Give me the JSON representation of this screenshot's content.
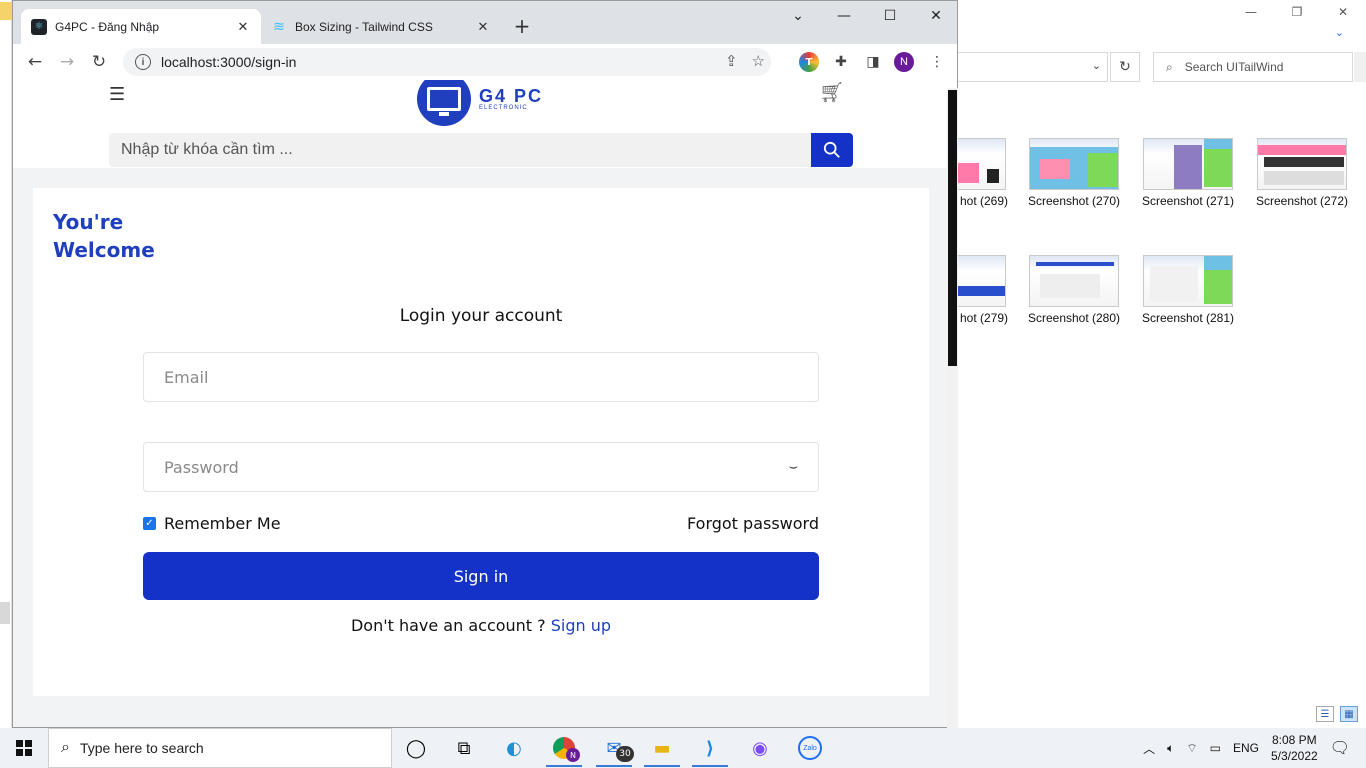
{
  "explorer": {
    "search_placeholder": "Search UITailWind",
    "thumbnails": [
      {
        "label": "hot (269)"
      },
      {
        "label": "Screenshot (270)"
      },
      {
        "label": "Screenshot (271)"
      },
      {
        "label": "Screenshot (272)"
      },
      {
        "label": "hot (279)"
      },
      {
        "label": "Screenshot (280)"
      },
      {
        "label": "Screenshot (281)"
      }
    ]
  },
  "browser": {
    "tabs": [
      {
        "title": "G4PC - Đăng Nhập"
      },
      {
        "title": "Box Sizing - Tailwind CSS"
      }
    ],
    "url": "localhost:3000/sign-in",
    "profile_initial": "N",
    "ext_initial": "T"
  },
  "site": {
    "logo_brand": "G4 PC",
    "logo_sub": "ELECTRONIC",
    "search_placeholder": "Nhập từ khóa cần tìm ..."
  },
  "login": {
    "welcome_line1": "You're",
    "welcome_line2": "Welcome",
    "title": "Login your account",
    "email_placeholder": "Email",
    "password_placeholder": "Password",
    "remember_label": "Remember Me",
    "remember_checked": true,
    "forgot_label": "Forgot password",
    "signin_label": "Sign in",
    "no_account_text": "Don't have an account ?",
    "signup_label": "Sign up"
  },
  "taskbar": {
    "search_placeholder": "Type here to search",
    "mail_badge": "30",
    "chrome_badge": "N",
    "zalo_label": "Zalo",
    "lang": "ENG",
    "time": "8:08 PM",
    "date": "5/3/2022"
  },
  "colors": {
    "primary": "#1432c7",
    "brand": "#1f3fbf"
  }
}
